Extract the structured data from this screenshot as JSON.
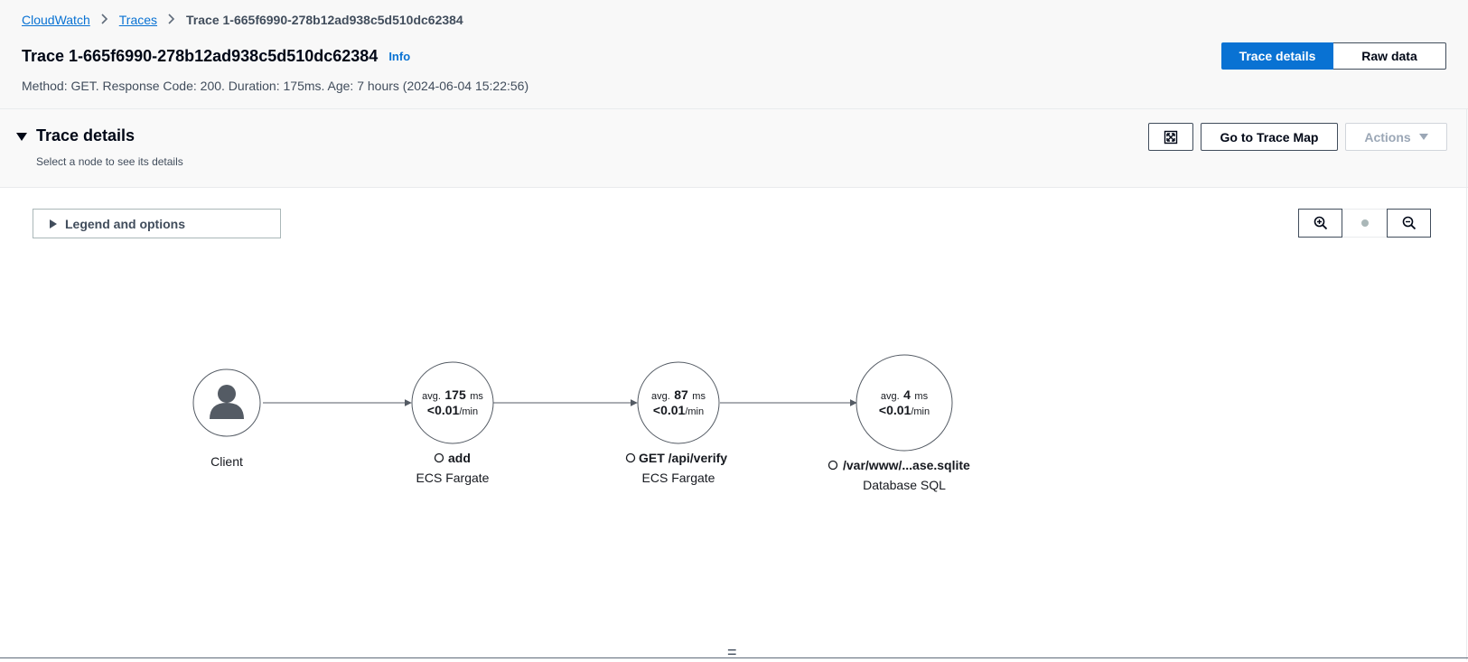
{
  "breadcrumb": {
    "items": [
      "CloudWatch",
      "Traces"
    ],
    "current": "Trace 1-665f6990-278b12ad938c5d510dc62384"
  },
  "header": {
    "title": "Trace 1-665f6990-278b12ad938c5d510dc62384",
    "info": "Info",
    "subtitle": "Method: GET. Response Code: 200. Duration: 175ms. Age: 7 hours (2024-06-04 15:22:56)",
    "tabs": {
      "active": "Trace details",
      "inactive": "Raw data"
    }
  },
  "panel": {
    "title": "Trace details",
    "description": "Select a node to see its details",
    "go_to_map": "Go to Trace Map",
    "actions": "Actions"
  },
  "legend": {
    "label": "Legend and options"
  },
  "map": {
    "client": {
      "label": "Client"
    },
    "nodes": [
      {
        "avg_prefix": "avg.",
        "avg_value": "175",
        "avg_unit": "ms",
        "rate_value": "<0.01",
        "rate_unit": "/min",
        "name": "add",
        "type": "ECS Fargate"
      },
      {
        "avg_prefix": "avg.",
        "avg_value": "87",
        "avg_unit": "ms",
        "rate_value": "<0.01",
        "rate_unit": "/min",
        "name": "GET /api/verify",
        "type": "ECS Fargate"
      },
      {
        "avg_prefix": "avg.",
        "avg_value": "4",
        "avg_unit": "ms",
        "rate_value": "<0.01",
        "rate_unit": "/min",
        "name": "/var/www/...ase.sqlite",
        "type": "Database SQL"
      }
    ]
  },
  "colors": {
    "primary": "#0972d3",
    "text": "#16191f",
    "muted": "#414d5c",
    "edge": "#545b64"
  },
  "icons": [
    "chevron-right-icon",
    "caret-down-icon",
    "caret-right-icon",
    "fullscreen-icon",
    "triangle-down-icon",
    "zoom-in-icon",
    "zoom-out-icon",
    "user-icon",
    "resize-handle-icon"
  ],
  "handle": "="
}
